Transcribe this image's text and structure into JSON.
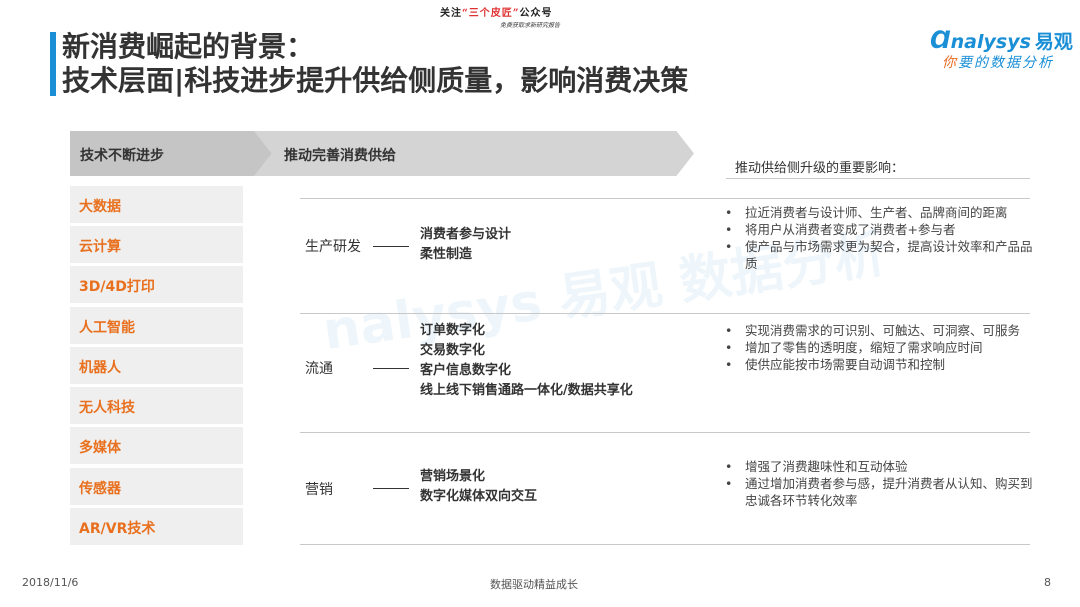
{
  "top_note": {
    "prefix": "关注",
    "highlight": "“三个皮匠”",
    "suffix": "公众号",
    "line2": "免费获取求新研究报告"
  },
  "title": {
    "line1": "新消费崛起的背景：",
    "line2": "技术层面|科技进步提升供给侧质量，影响消费决策"
  },
  "logo": {
    "brand": "nalysys",
    "brand_cn": "易观",
    "tagline_prefix": "你",
    "tagline": "要的数据分析"
  },
  "left_header": "技术不断进步",
  "arrow_header": "推动完善消费供给",
  "tech_items": [
    "大数据",
    "云计算",
    "3D/4D打印",
    "人工智能",
    "机器人",
    "无人科技",
    "多媒体",
    "传感器",
    "AR/VR技术"
  ],
  "impact_title": "推动供给侧升级的重要影响：",
  "sections": [
    {
      "category": "生产研发",
      "subs": [
        "消费者参与设计",
        "柔性制造"
      ],
      "bullets": [
        "拉近消费者与设计师、生产者、品牌商间的距离",
        "将用户从消费者变成了消费者+参与者",
        "使产品与市场需求更为契合，提高设计效率和产品品质"
      ]
    },
    {
      "category": "流通",
      "subs": [
        "订单数字化",
        "交易数字化",
        "客户信息数字化",
        "线上线下销售通路一体化/数据共享化"
      ],
      "bullets": [
        "实现消费需求的可识别、可触达、可洞察、可服务",
        "增加了零售的透明度，缩短了需求响应时间",
        "使供应能按市场需要自动调节和控制"
      ]
    },
    {
      "category": "营销",
      "subs": [
        "营销场景化",
        "数字化媒体双向交互"
      ],
      "bullets": [
        "增强了消费趣味性和互动体验",
        "通过增加消费者参与感，提升消费者从认知、购买到忠诚各环节转化效率"
      ]
    }
  ],
  "watermark": "nalysys 易观 数据分析",
  "footer": {
    "date": "2018/11/6",
    "center": "数据驱动精益成长",
    "page": "8"
  }
}
